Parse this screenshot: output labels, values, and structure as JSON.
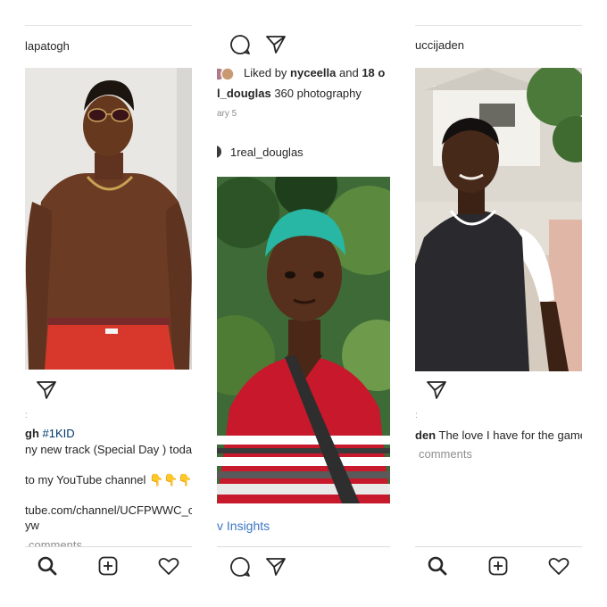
{
  "panel1": {
    "username": "lapatogh",
    "caption_user": "gh",
    "hashtag": "#1KID",
    "line2": "ny new track (Special Day ) today",
    "line3": "to my YouTube channel",
    "emojis": "👇👇👇",
    "url": "tube.com/channel/UCFPWWC_c",
    "url_cont": "yw",
    "comments": "comments"
  },
  "panel2": {
    "liked_prefix": "Liked by",
    "liked_user": "nyceella",
    "liked_and": "and",
    "liked_count": "18 o",
    "caption_user": "l_douglas",
    "caption_text": "360 photography",
    "date": "ary 5",
    "username": "1real_douglas",
    "insights": "v Insights"
  },
  "panel3": {
    "username": "uccijaden",
    "caption_user": "den",
    "caption_text": "The love I have for the game",
    "comments": "comments",
    "dot": ":"
  },
  "colors": {
    "text": "#262626",
    "muted": "#8e8e8e",
    "hashtag": "#00376b",
    "link": "#3b76c4",
    "pants_red": "#d8382b",
    "hair_teal": "#28b7a5",
    "shirt_red": "#c8182b",
    "jersey": "#2a2a2e"
  },
  "icons": [
    "share-icon",
    "comment-icon",
    "search-icon",
    "add-post-icon",
    "heart-icon"
  ]
}
